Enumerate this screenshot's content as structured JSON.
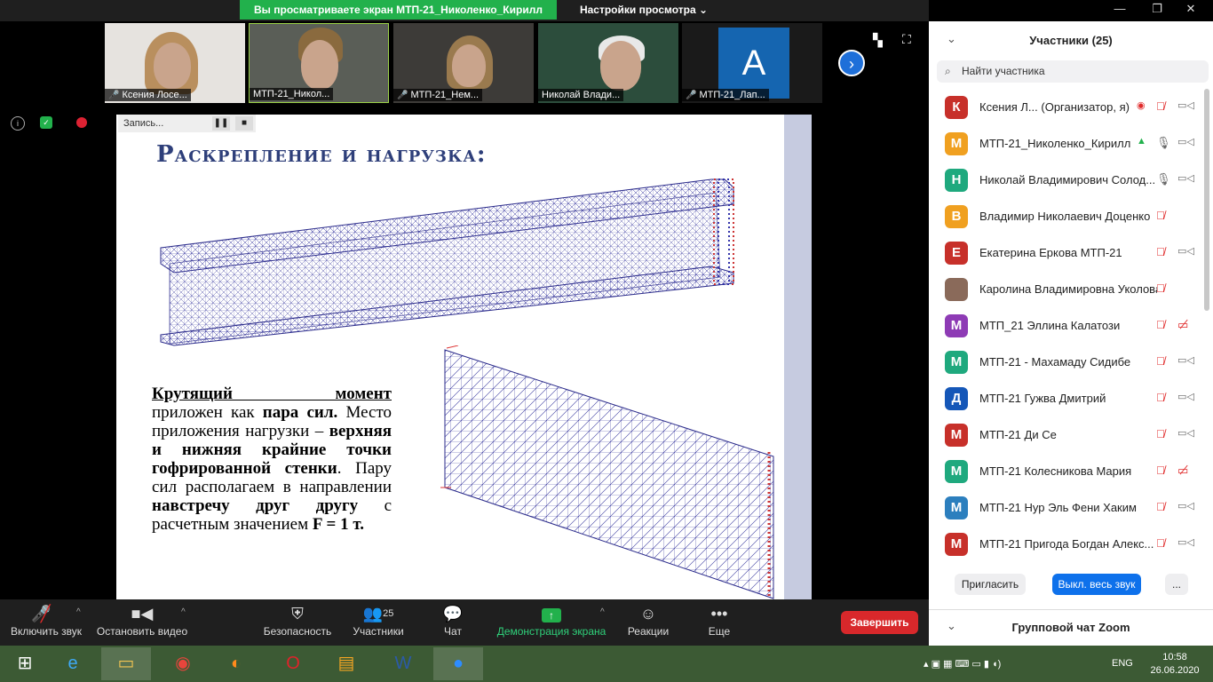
{
  "top": {
    "share_banner": "Вы просматриваете экран МТП-21_Николенко_Кирилл",
    "view_settings": "Настройки просмотра"
  },
  "thumbnails": [
    {
      "label": "Ксения Лосе..."
    },
    {
      "label": "МТП-21_Никол..."
    },
    {
      "label": "МТП-21_Нем..."
    },
    {
      "label": "Николай Влади..."
    },
    {
      "label": "МТП-21_Лап...",
      "avatar_letter": "A"
    }
  ],
  "recording": {
    "label": "Запись..."
  },
  "slide": {
    "title": "Раскрепление и нагрузка:",
    "p1_bold_underline": "Крутящий момент",
    "p1_a": "приложен как",
    "p1_b": "пара сил.",
    "p1_c": "Место приложения нагрузки –",
    "p1_d": "верхняя и нижняя крайние точки гофрированной стенки",
    "p1_e": ". Пару сил располагаем в направлении",
    "p1_f": "навстречу друг другу",
    "p1_g": "с расчетным значением",
    "p1_h": "F = 1 т."
  },
  "toolbar": {
    "mute": "Включить звук",
    "video": "Остановить видео",
    "security": "Безопасность",
    "participants": "Участники",
    "participants_count": "25",
    "chat": "Чат",
    "share": "Демонстрация экрана",
    "reactions": "Реакции",
    "more": "Еще",
    "end": "Завершить"
  },
  "panel": {
    "title": "Участники (25)",
    "search_placeholder": "Найти участника",
    "participants": [
      {
        "letter": "К",
        "name": "Ксения Л...  (Организатор, я)",
        "color": "#c7302a"
      },
      {
        "letter": "М",
        "name": "МТП-21_Николенко_Кирилл",
        "color": "#f0a020"
      },
      {
        "letter": "Н",
        "name": "Николай Владимирович Солод...",
        "color": "#1fa97e"
      },
      {
        "letter": "В",
        "name": "Владимир Николаевич Доценко",
        "color": "#f0a020"
      },
      {
        "letter": "Е",
        "name": "Екатерина Еркова МТП-21",
        "color": "#c7302a"
      },
      {
        "letter": "",
        "name": "Каролина Владимировна Уколова",
        "color": "#8a6a5a"
      },
      {
        "letter": "М",
        "name": "МТП_21 Эллина Калатози",
        "color": "#8e3bb5"
      },
      {
        "letter": "М",
        "name": "МТП-21 - Махамаду Сидибе",
        "color": "#1fa97e"
      },
      {
        "letter": "Д",
        "name": "МТП-21 Гужва Дмитрий",
        "color": "#1557b8"
      },
      {
        "letter": "М",
        "name": "МТП-21 Ди Се",
        "color": "#c7302a"
      },
      {
        "letter": "М",
        "name": "МТП-21 Колесникова Мария",
        "color": "#1fa97e"
      },
      {
        "letter": "М",
        "name": "МТП-21 Нур Эль Фени Хаким",
        "color": "#2c7fbe"
      },
      {
        "letter": "М",
        "name": "МТП-21 Пригода Богдан Алекс...",
        "color": "#c7302a"
      }
    ],
    "invite": "Пригласить",
    "mute_all": "Выкл. весь звук",
    "more": "...",
    "chat_title": "Групповой чат Zoom"
  },
  "taskbar": {
    "lang": "ENG",
    "time": "10:58",
    "date": "26.06.2020"
  }
}
